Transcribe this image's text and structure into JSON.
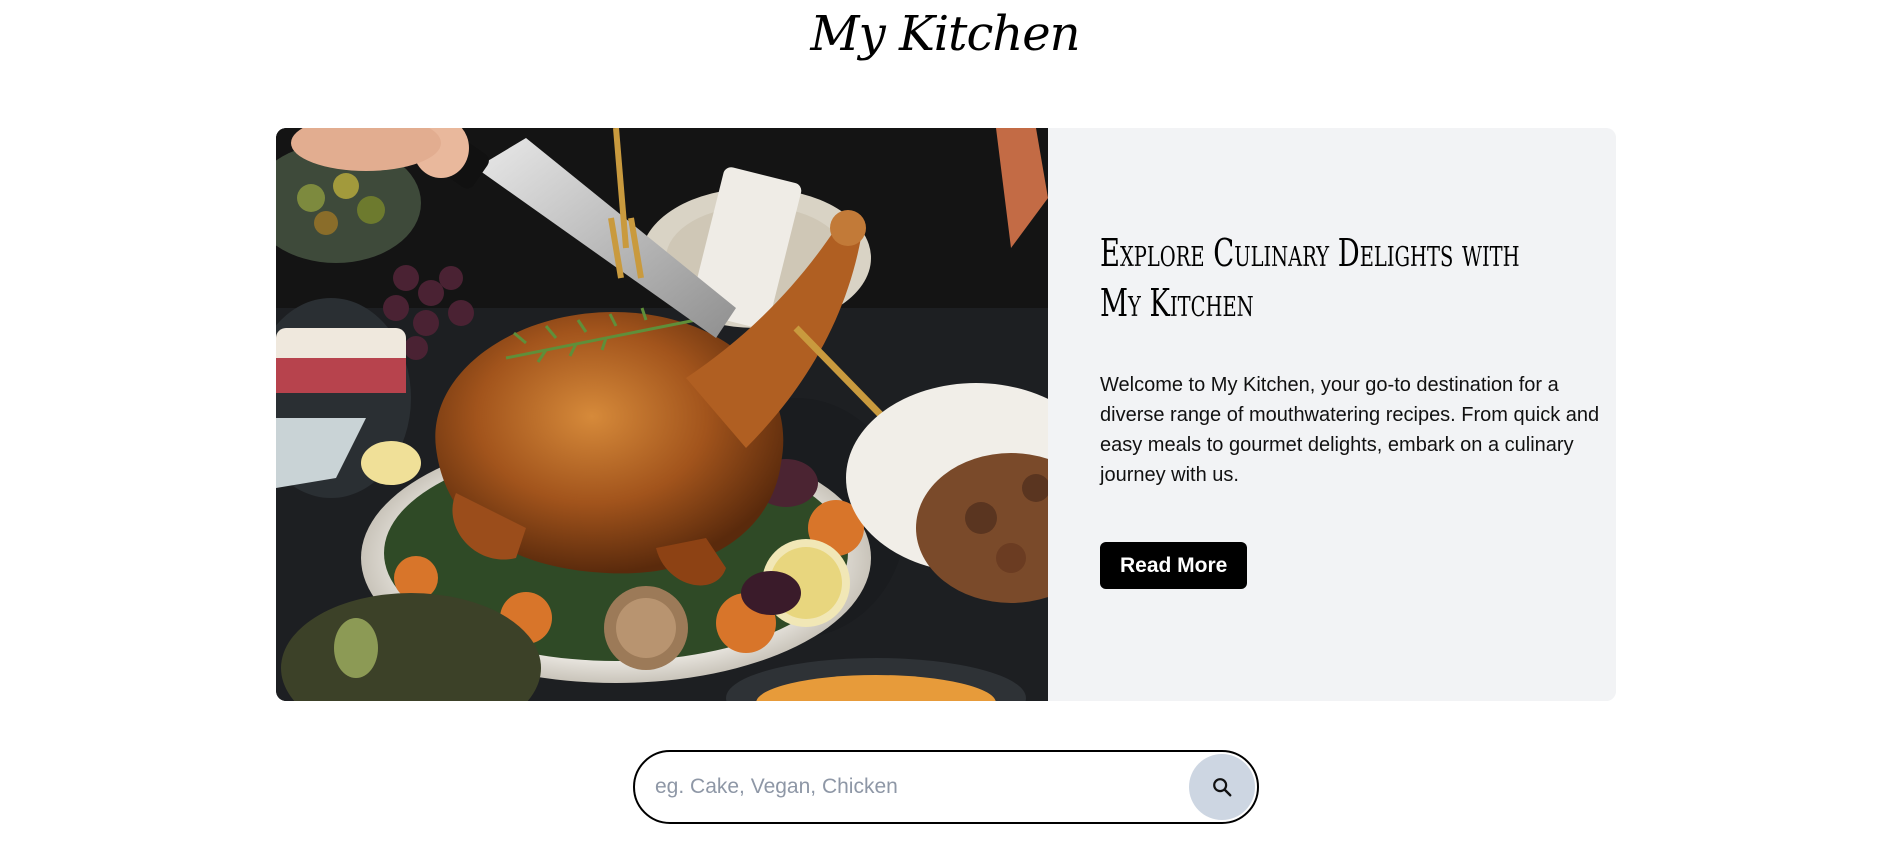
{
  "header": {
    "logo": "My Kitchen"
  },
  "hero": {
    "image_alt": "Roast chicken being carved on a dinner table",
    "title": "Explore Culinary Delights with My Kitchen",
    "description": "Welcome to My Kitchen, your go-to destination for a diverse range of mouthwatering recipes. From quick and easy meals to gourmet delights, embark on a culinary journey with us.",
    "button_label": "Read More"
  },
  "search": {
    "placeholder": "eg. Cake, Vegan, Chicken",
    "value": "",
    "button_icon": "search-icon"
  },
  "colors": {
    "panel_bg": "#f2f3f5",
    "button_bg": "#000000",
    "search_button_bg": "#cdd6e2",
    "placeholder": "#8e97a6"
  }
}
